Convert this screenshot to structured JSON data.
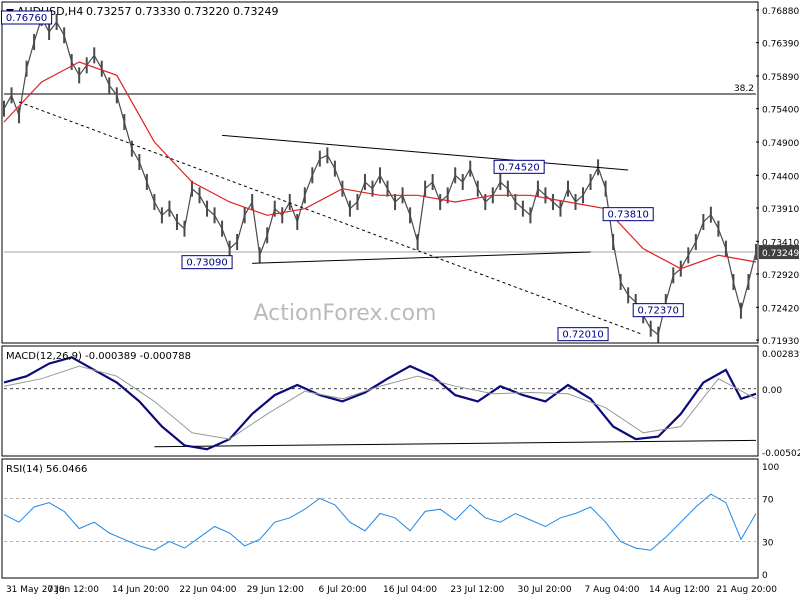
{
  "header": {
    "symbol": "AUDUSD,H4",
    "ohlc": "0.73257 0.73330 0.73220 0.73249"
  },
  "watermark": "ActionForex.com",
  "colors": {
    "price": "#4a4a4a",
    "ma": "#e02020",
    "macd": "#0a0a7a",
    "signal": "#999999",
    "rsi": "#1e88e5",
    "label_border": "#000080",
    "current_price_bg": "#404040"
  },
  "chart_data": [
    {
      "type": "line",
      "name": "price",
      "y_ticks": [
        "0.76880",
        "0.76390",
        "0.75890",
        "0.75400",
        "0.74900",
        "0.74400",
        "0.73910",
        "0.73410",
        "0.72920",
        "0.72420",
        "0.71930"
      ],
      "ylim": [
        0.7193,
        0.7688
      ],
      "current_price": "0.73249",
      "fib_level": {
        "label": "38.2",
        "value": 0.7562
      },
      "horizontal_level": 0.7325,
      "x_labels": [
        "31 May 2018",
        "7 Jun 12:00",
        "14 Jun 20:00",
        "22 Jun 04:00",
        "29 Jun 12:00",
        "6 Jul 20:00",
        "16 Jul 04:00",
        "23 Jul 12:00",
        "30 Jul 20:00",
        "7 Aug 04:00",
        "14 Aug 12:00",
        "21 Aug 20:00"
      ],
      "annotations": [
        {
          "text": "0.76760",
          "x": 0.03,
          "y": 0.7676
        },
        {
          "text": "0.73090",
          "x": 0.27,
          "y": 0.7309
        },
        {
          "text": "0.74520",
          "x": 0.685,
          "y": 0.7452
        },
        {
          "text": "0.73810",
          "x": 0.83,
          "y": 0.7381
        },
        {
          "text": "0.72370",
          "x": 0.87,
          "y": 0.7237
        },
        {
          "text": "0.72010",
          "x": 0.77,
          "y": 0.7201
        }
      ],
      "series": [
        {
          "points": [
            [
              0,
              0.754
            ],
            [
              0.01,
              0.756
            ],
            [
              0.02,
              0.753
            ],
            [
              0.03,
              0.76
            ],
            [
              0.04,
              0.764
            ],
            [
              0.05,
              0.7676
            ],
            [
              0.06,
              0.7655
            ],
            [
              0.07,
              0.767
            ],
            [
              0.08,
              0.765
            ],
            [
              0.09,
              0.761
            ],
            [
              0.1,
              0.759
            ],
            [
              0.11,
              0.7605
            ],
            [
              0.12,
              0.762
            ],
            [
              0.13,
              0.76
            ],
            [
              0.14,
              0.7575
            ],
            [
              0.15,
              0.756
            ],
            [
              0.16,
              0.752
            ],
            [
              0.17,
              0.748
            ],
            [
              0.18,
              0.746
            ],
            [
              0.19,
              0.743
            ],
            [
              0.2,
              0.74
            ],
            [
              0.21,
              0.738
            ],
            [
              0.22,
              0.739
            ],
            [
              0.23,
              0.737
            ],
            [
              0.24,
              0.736
            ],
            [
              0.25,
              0.742
            ],
            [
              0.26,
              0.741
            ],
            [
              0.27,
              0.739
            ],
            [
              0.28,
              0.738
            ],
            [
              0.29,
              0.736
            ],
            [
              0.3,
              0.733
            ],
            [
              0.31,
              0.734
            ],
            [
              0.32,
              0.738
            ],
            [
              0.33,
              0.74
            ],
            [
              0.34,
              0.732
            ],
            [
              0.35,
              0.735
            ],
            [
              0.36,
              0.739
            ],
            [
              0.37,
              0.738
            ],
            [
              0.38,
              0.74
            ],
            [
              0.39,
              0.737
            ],
            [
              0.4,
              0.741
            ],
            [
              0.41,
              0.744
            ],
            [
              0.42,
              0.7465
            ],
            [
              0.43,
              0.747
            ],
            [
              0.44,
              0.745
            ],
            [
              0.45,
              0.742
            ],
            [
              0.46,
              0.739
            ],
            [
              0.47,
              0.74
            ],
            [
              0.48,
              0.743
            ],
            [
              0.49,
              0.742
            ],
            [
              0.5,
              0.744
            ],
            [
              0.51,
              0.742
            ],
            [
              0.52,
              0.74
            ],
            [
              0.53,
              0.741
            ],
            [
              0.54,
              0.738
            ],
            [
              0.55,
              0.734
            ],
            [
              0.56,
              0.742
            ],
            [
              0.57,
              0.743
            ],
            [
              0.58,
              0.74
            ],
            [
              0.59,
              0.741
            ],
            [
              0.6,
              0.744
            ],
            [
              0.61,
              0.743
            ],
            [
              0.62,
              0.745
            ],
            [
              0.63,
              0.742
            ],
            [
              0.64,
              0.74
            ],
            [
              0.65,
              0.741
            ],
            [
              0.66,
              0.743
            ],
            [
              0.67,
              0.742
            ],
            [
              0.68,
              0.74
            ],
            [
              0.69,
              0.739
            ],
            [
              0.7,
              0.738
            ],
            [
              0.71,
              0.742
            ],
            [
              0.72,
              0.741
            ],
            [
              0.73,
              0.74
            ],
            [
              0.74,
              0.739
            ],
            [
              0.75,
              0.742
            ],
            [
              0.76,
              0.74
            ],
            [
              0.77,
              0.741
            ],
            [
              0.78,
              0.743
            ],
            [
              0.79,
              0.7452
            ],
            [
              0.8,
              0.742
            ],
            [
              0.81,
              0.734
            ],
            [
              0.82,
              0.728
            ],
            [
              0.83,
              0.726
            ],
            [
              0.84,
              0.725
            ],
            [
              0.85,
              0.723
            ],
            [
              0.86,
              0.721
            ],
            [
              0.87,
              0.7201
            ],
            [
              0.88,
              0.725
            ],
            [
              0.89,
              0.729
            ],
            [
              0.9,
              0.73
            ],
            [
              0.91,
              0.732
            ],
            [
              0.92,
              0.734
            ],
            [
              0.93,
              0.737
            ],
            [
              0.94,
              0.7381
            ],
            [
              0.95,
              0.736
            ],
            [
              0.96,
              0.733
            ],
            [
              0.97,
              0.728
            ],
            [
              0.98,
              0.7237
            ],
            [
              0.99,
              0.728
            ],
            [
              1.0,
              0.7325
            ]
          ]
        }
      ],
      "moving_average": [
        [
          0,
          0.752
        ],
        [
          0.05,
          0.758
        ],
        [
          0.1,
          0.761
        ],
        [
          0.15,
          0.759
        ],
        [
          0.2,
          0.749
        ],
        [
          0.25,
          0.743
        ],
        [
          0.3,
          0.74
        ],
        [
          0.35,
          0.738
        ],
        [
          0.4,
          0.739
        ],
        [
          0.45,
          0.742
        ],
        [
          0.5,
          0.741
        ],
        [
          0.55,
          0.741
        ],
        [
          0.6,
          0.74
        ],
        [
          0.65,
          0.741
        ],
        [
          0.7,
          0.741
        ],
        [
          0.75,
          0.74
        ],
        [
          0.8,
          0.739
        ],
        [
          0.85,
          0.733
        ],
        [
          0.9,
          0.73
        ],
        [
          0.95,
          0.732
        ],
        [
          1.0,
          0.731
        ]
      ]
    },
    {
      "type": "line",
      "name": "MACD",
      "title": "MACD(12,26,9) -0.000389 -0.000788",
      "y_ticks": [
        "0.002839",
        "0.00",
        "-0.005021"
      ],
      "ylim": [
        -0.005021,
        0.002839
      ],
      "series": [
        {
          "name": "macd",
          "points": [
            [
              0,
              0.0005
            ],
            [
              0.03,
              0.001
            ],
            [
              0.06,
              0.002
            ],
            [
              0.09,
              0.0025
            ],
            [
              0.12,
              0.0015
            ],
            [
              0.15,
              0.0005
            ],
            [
              0.18,
              -0.001
            ],
            [
              0.21,
              -0.003
            ],
            [
              0.24,
              -0.0045
            ],
            [
              0.27,
              -0.0048
            ],
            [
              0.3,
              -0.004
            ],
            [
              0.33,
              -0.002
            ],
            [
              0.36,
              -0.0005
            ],
            [
              0.39,
              0.0003
            ],
            [
              0.42,
              -0.0005
            ],
            [
              0.45,
              -0.001
            ],
            [
              0.48,
              -0.0003
            ],
            [
              0.51,
              0.0008
            ],
            [
              0.54,
              0.0018
            ],
            [
              0.57,
              0.001
            ],
            [
              0.6,
              -0.0005
            ],
            [
              0.63,
              -0.001
            ],
            [
              0.66,
              0.0002
            ],
            [
              0.69,
              -0.0005
            ],
            [
              0.72,
              -0.001
            ],
            [
              0.75,
              0.0003
            ],
            [
              0.78,
              -0.0008
            ],
            [
              0.81,
              -0.003
            ],
            [
              0.84,
              -0.004
            ],
            [
              0.87,
              -0.0038
            ],
            [
              0.9,
              -0.002
            ],
            [
              0.93,
              0.0005
            ],
            [
              0.96,
              0.0015
            ],
            [
              0.98,
              -0.0008
            ],
            [
              1.0,
              -0.0004
            ]
          ]
        },
        {
          "name": "signal",
          "points": [
            [
              0,
              0.0002
            ],
            [
              0.05,
              0.0008
            ],
            [
              0.1,
              0.0018
            ],
            [
              0.15,
              0.001
            ],
            [
              0.2,
              -0.001
            ],
            [
              0.25,
              -0.0035
            ],
            [
              0.3,
              -0.004
            ],
            [
              0.35,
              -0.002
            ],
            [
              0.4,
              -0.0002
            ],
            [
              0.45,
              -0.0008
            ],
            [
              0.5,
              0.0002
            ],
            [
              0.55,
              0.001
            ],
            [
              0.6,
              0.0002
            ],
            [
              0.65,
              -0.0004
            ],
            [
              0.7,
              -0.0003
            ],
            [
              0.75,
              -0.0004
            ],
            [
              0.8,
              -0.0015
            ],
            [
              0.85,
              -0.0035
            ],
            [
              0.9,
              -0.003
            ],
            [
              0.95,
              0.0008
            ],
            [
              1.0,
              -0.0008
            ]
          ]
        }
      ]
    },
    {
      "type": "line",
      "name": "RSI",
      "title": "RSI(14) 56.0466",
      "y_ticks": [
        "100",
        "70",
        "30",
        "0"
      ],
      "ylim": [
        0,
        100
      ],
      "series": [
        {
          "name": "rsi",
          "points": [
            [
              0,
              55
            ],
            [
              0.02,
              48
            ],
            [
              0.04,
              62
            ],
            [
              0.06,
              66
            ],
            [
              0.08,
              58
            ],
            [
              0.1,
              42
            ],
            [
              0.12,
              48
            ],
            [
              0.14,
              38
            ],
            [
              0.16,
              32
            ],
            [
              0.18,
              26
            ],
            [
              0.2,
              22
            ],
            [
              0.22,
              30
            ],
            [
              0.24,
              24
            ],
            [
              0.26,
              34
            ],
            [
              0.28,
              44
            ],
            [
              0.3,
              38
            ],
            [
              0.32,
              26
            ],
            [
              0.34,
              32
            ],
            [
              0.36,
              48
            ],
            [
              0.38,
              52
            ],
            [
              0.4,
              60
            ],
            [
              0.42,
              70
            ],
            [
              0.44,
              64
            ],
            [
              0.46,
              48
            ],
            [
              0.48,
              40
            ],
            [
              0.5,
              56
            ],
            [
              0.52,
              52
            ],
            [
              0.54,
              40
            ],
            [
              0.56,
              58
            ],
            [
              0.58,
              60
            ],
            [
              0.6,
              50
            ],
            [
              0.62,
              64
            ],
            [
              0.64,
              52
            ],
            [
              0.66,
              48
            ],
            [
              0.68,
              56
            ],
            [
              0.7,
              50
            ],
            [
              0.72,
              44
            ],
            [
              0.74,
              52
            ],
            [
              0.76,
              56
            ],
            [
              0.78,
              62
            ],
            [
              0.8,
              48
            ],
            [
              0.82,
              30
            ],
            [
              0.84,
              24
            ],
            [
              0.86,
              22
            ],
            [
              0.88,
              34
            ],
            [
              0.9,
              48
            ],
            [
              0.92,
              62
            ],
            [
              0.94,
              74
            ],
            [
              0.96,
              66
            ],
            [
              0.98,
              32
            ],
            [
              1.0,
              56
            ]
          ]
        }
      ]
    }
  ]
}
